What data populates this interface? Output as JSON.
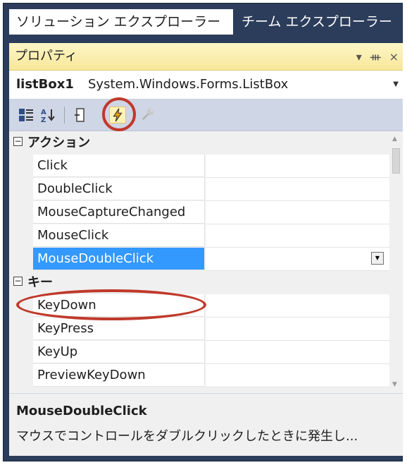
{
  "tabs": [
    {
      "label": "ソリューション エクスプローラー",
      "active": true
    },
    {
      "label": "チーム エクスプローラー",
      "active": false
    }
  ],
  "panel": {
    "title": "プロパティ",
    "title_buttons": {
      "dropdown": "▾",
      "pin": "ᚒ",
      "close": "×"
    }
  },
  "object_selector": {
    "name": "listBox1",
    "type": "System.Windows.Forms.ListBox"
  },
  "toolbar": {
    "buttons": [
      "categorized-icon",
      "alphabetical-icon",
      "property-pages-icon",
      "events-icon",
      "wrench-icon"
    ]
  },
  "grid": {
    "categories": [
      {
        "label": "アクション",
        "expanded": true,
        "items": [
          "Click",
          "DoubleClick",
          "MouseCaptureChanged",
          "MouseClick",
          "MouseDoubleClick"
        ]
      },
      {
        "label": "キー",
        "expanded": true,
        "items": [
          "KeyDown",
          "KeyPress",
          "KeyUp",
          "PreviewKeyDown"
        ]
      }
    ],
    "selected": "MouseDoubleClick",
    "toggle_symbol": "−"
  },
  "description": {
    "title": "MouseDoubleClick",
    "text": "マウスでコントロールをダブルクリックしたときに発生し..."
  },
  "colors": {
    "selection": "#3399ff",
    "highlight_ring": "#c0392b",
    "frame": "#2b3d5b",
    "title_bar": "#f8e79a"
  }
}
